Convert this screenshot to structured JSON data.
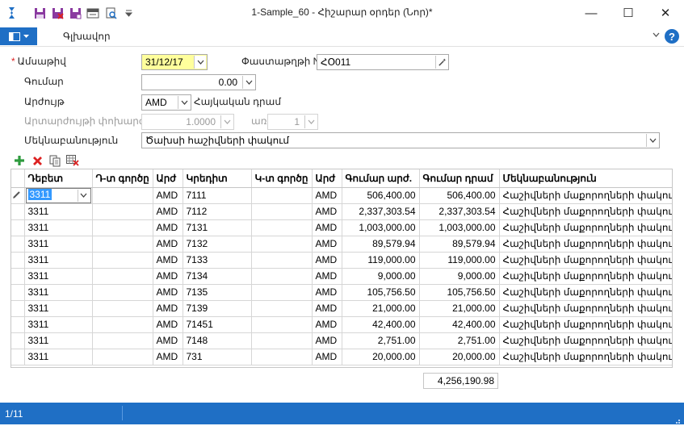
{
  "window": {
    "title": "1-Sample_60 - Հիշարար օրդեր (Նոր)*",
    "controls": {
      "minimize": "—",
      "maximize": "☐",
      "close": "✕"
    }
  },
  "quick_access": {
    "icons": [
      "app-logo-icon",
      "save-icon",
      "save-close-icon",
      "save-new-icon",
      "export-icon",
      "preview-icon",
      "customize-dropdown-icon"
    ]
  },
  "ribbon": {
    "main_tab": "Գլխավոր",
    "help": "?"
  },
  "form": {
    "date": {
      "label": "Ամսաթիվ",
      "value": "31/12/17",
      "required": "*"
    },
    "document_number": {
      "label": "Փաստաթղթի N",
      "value": "ՀՕ011"
    },
    "amount": {
      "label": "Գումար",
      "value": "0.00"
    },
    "currency": {
      "label": "Արժույթ",
      "value": "AMD",
      "description": "Հայկական դրամ"
    },
    "exchange_rate": {
      "label": "Արտարժույթի փոխարժեք",
      "value": "1.0000",
      "by_label": "առ",
      "by_value": "1"
    },
    "comment": {
      "label": "Մեկնաբանություն",
      "value": "Ծախսի հաշիվների փակում"
    }
  },
  "grid": {
    "columns": [
      "Դեբետ",
      "Դ-տ գործը",
      "Արժ",
      "Կրեդիտ",
      "Կ-տ գործը",
      "Արժ",
      "Գումար արժ.",
      "Գումար դրամ",
      "Մեկնաբանություն"
    ],
    "rows": [
      [
        "3311",
        "",
        "AMD",
        "7111",
        "",
        "AMD",
        "506,400.00",
        "506,400.00",
        "Հաշիվների մաքորողների փակում"
      ],
      [
        "3311",
        "",
        "AMD",
        "7112",
        "",
        "AMD",
        "2,337,303.54",
        "2,337,303.54",
        "Հաշիվների մաքորողների փակում"
      ],
      [
        "3311",
        "",
        "AMD",
        "7131",
        "",
        "AMD",
        "1,003,000.00",
        "1,003,000.00",
        "Հաշիվների մաքորողների փակում"
      ],
      [
        "3311",
        "",
        "AMD",
        "7132",
        "",
        "AMD",
        "89,579.94",
        "89,579.94",
        "Հաշիվների մաքորողների փակում"
      ],
      [
        "3311",
        "",
        "AMD",
        "7133",
        "",
        "AMD",
        "119,000.00",
        "119,000.00",
        "Հաշիվների մաքորողների փակում"
      ],
      [
        "3311",
        "",
        "AMD",
        "7134",
        "",
        "AMD",
        "9,000.00",
        "9,000.00",
        "Հաշիվների մաքորողների փակում"
      ],
      [
        "3311",
        "",
        "AMD",
        "7135",
        "",
        "AMD",
        "105,756.50",
        "105,756.50",
        "Հաշիվների մաքորողների փակում"
      ],
      [
        "3311",
        "",
        "AMD",
        "7139",
        "",
        "AMD",
        "21,000.00",
        "21,000.00",
        "Հաշիվների մաքորողների փակում"
      ],
      [
        "3311",
        "",
        "AMD",
        "71451",
        "",
        "AMD",
        "42,400.00",
        "42,400.00",
        "Հաշիվների մաքորողների փակում"
      ],
      [
        "3311",
        "",
        "AMD",
        "7148",
        "",
        "AMD",
        "2,751.00",
        "2,751.00",
        "Հաշիվների մաքորողների փակում"
      ],
      [
        "3311",
        "",
        "AMD",
        "731",
        "",
        "AMD",
        "20,000.00",
        "20,000.00",
        "Հաշիվների մաքորողների փակում"
      ]
    ],
    "total_amd": "4,256,190.98"
  },
  "statusbar": {
    "record_count": "1/11"
  },
  "colors": {
    "accent": "#1f6fc5",
    "required": "#dd2222",
    "highlight": "#ffff9c",
    "selection": "#3399ff"
  }
}
